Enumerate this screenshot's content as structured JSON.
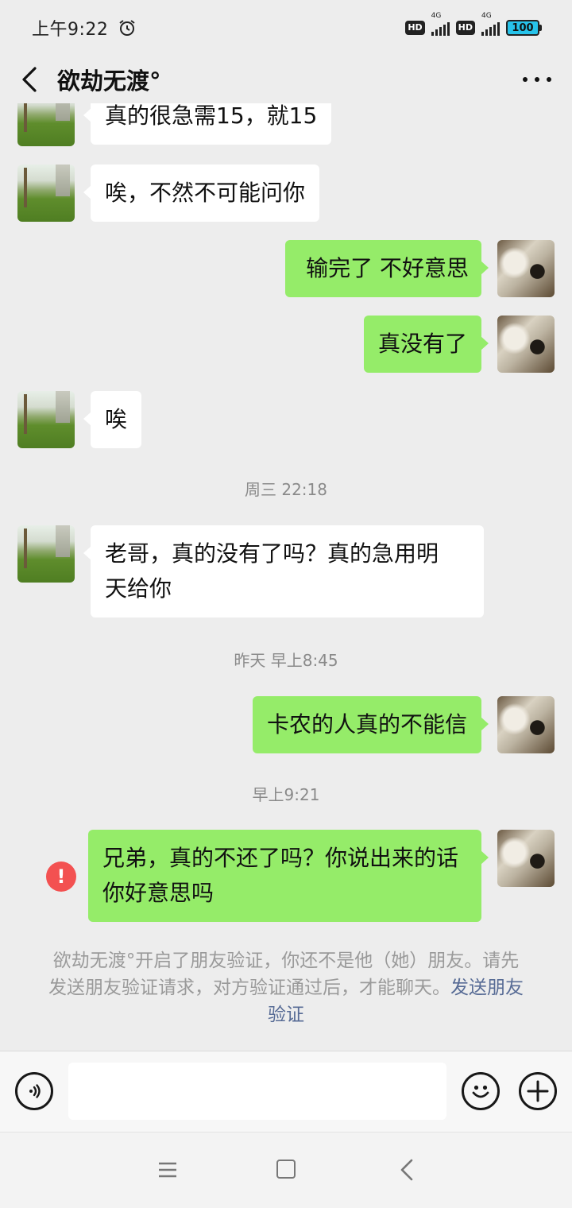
{
  "status_bar": {
    "time": "上午9:22",
    "hd_1": "HD",
    "network_1": "4G",
    "hd_2": "HD",
    "network_2": "4G",
    "battery": "100",
    "battery_color": "#27c3ea"
  },
  "header": {
    "title": "欲劫无渡°",
    "back_icon": "chevron-left-icon",
    "more_icon": "more-dots-icon"
  },
  "messages": [
    {
      "side": "in",
      "text": "真的很急需15，就15"
    },
    {
      "side": "in",
      "text": "唉，不然不可能问你"
    },
    {
      "side": "out",
      "text": "输完了 不好意思"
    },
    {
      "side": "out",
      "text": "真没有了"
    },
    {
      "side": "in",
      "text": "唉"
    },
    {
      "side": "in",
      "text": "老哥，真的没有了吗？真的急用明\n天给你"
    },
    {
      "side": "out",
      "text": "卡农的人真的不能信"
    },
    {
      "side": "out",
      "text": "兄弟，真的不还了吗？你说出来的话\n你好意思吗",
      "failed": true
    }
  ],
  "timestamps": [
    "周三 22:18",
    "昨天 早上8:45",
    "早上9:21"
  ],
  "error_mark": "!",
  "system_notice": {
    "text": "欲劫无渡°开启了朋友验证，你还不是他（她）朋友。请先发送朋友验证请求，对方验证通过后，才能聊天。",
    "link": "发送朋友验证",
    "link_color": "#576b95"
  },
  "input_bar": {
    "placeholder": "",
    "voice_icon": "voice-icon",
    "emoji_icon": "emoji-icon",
    "add_icon": "plus-icon"
  },
  "colors": {
    "background": "#ededed",
    "bubble_out": "#95ec69",
    "bubble_in": "#ffffff",
    "error": "#f35151"
  }
}
